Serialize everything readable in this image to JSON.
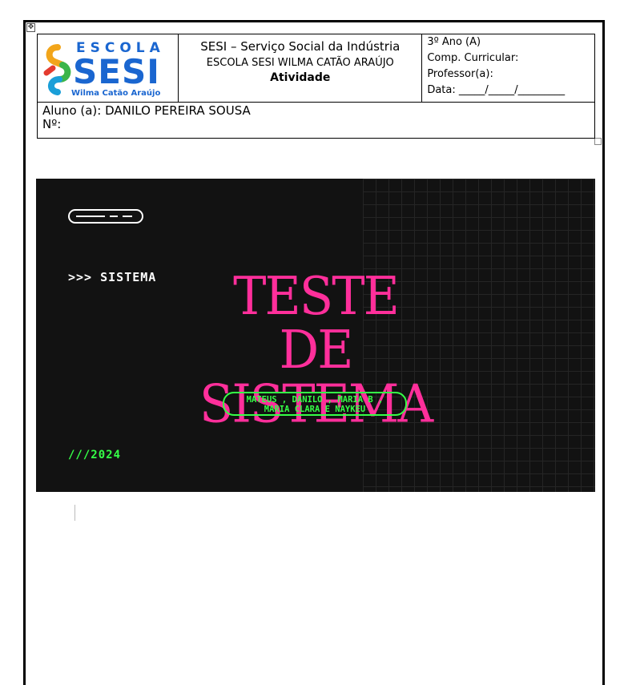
{
  "header": {
    "logo": {
      "escola": "ESCOLA",
      "sesi": "SESI",
      "subtitle": "Wilma Catão Araújo"
    },
    "line1": "SESI – Serviço Social da Indústria",
    "line2": "ESCOLA SESI WILMA CATÃO ARAÚJO",
    "line3": "Atividade",
    "right": {
      "ano": "3º Ano (A)",
      "comp": "Comp. Curricular:",
      "professor": "Professor(a):",
      "data": "Data: _____/_____/_________"
    },
    "aluno": "Aluno (a): DANILO PEREIRA SOUSA",
    "numero": "Nº:"
  },
  "slide": {
    "tag": ">>> SISTEMA",
    "title_line1": "TESTE DE",
    "title_line2": "SISTEMA",
    "names_line1": "MATEUS , DANILO , MARIA B ,",
    "names_line2": "MARIA CLARA E NAYKEU",
    "year": "///2024",
    "colors": {
      "background": "#121212",
      "title": "#ff2f9b",
      "accent": "#35ff47"
    }
  }
}
